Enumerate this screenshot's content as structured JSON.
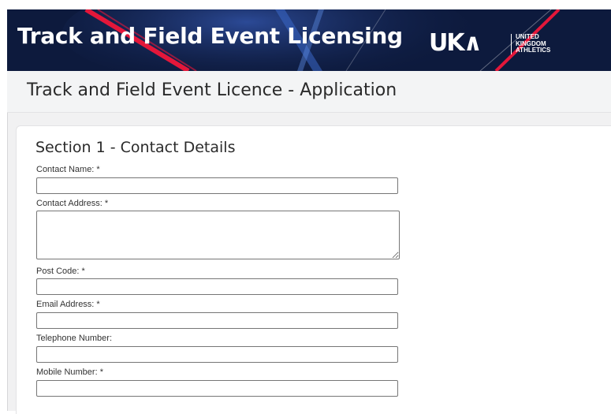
{
  "banner": {
    "title": "Track and Field Event Licensing",
    "logo_mark": "UK∧",
    "logo_text_lines": [
      "UNITED",
      "KINGDOM",
      "ATHLETICS"
    ],
    "background_color": "#0d1a3d",
    "accent_color": "#e4173a"
  },
  "page": {
    "title": "Track and Field Event Licence - Application"
  },
  "section": {
    "title": "Section 1 - Contact Details",
    "fields": [
      {
        "label": "Contact Name: *",
        "value": ""
      },
      {
        "label": "Contact Address: *",
        "value": ""
      },
      {
        "label": "Post Code: *",
        "value": ""
      },
      {
        "label": "Email Address: *",
        "value": ""
      },
      {
        "label": "Telephone Number:",
        "value": ""
      },
      {
        "label": "Mobile Number: *",
        "value": ""
      }
    ]
  }
}
